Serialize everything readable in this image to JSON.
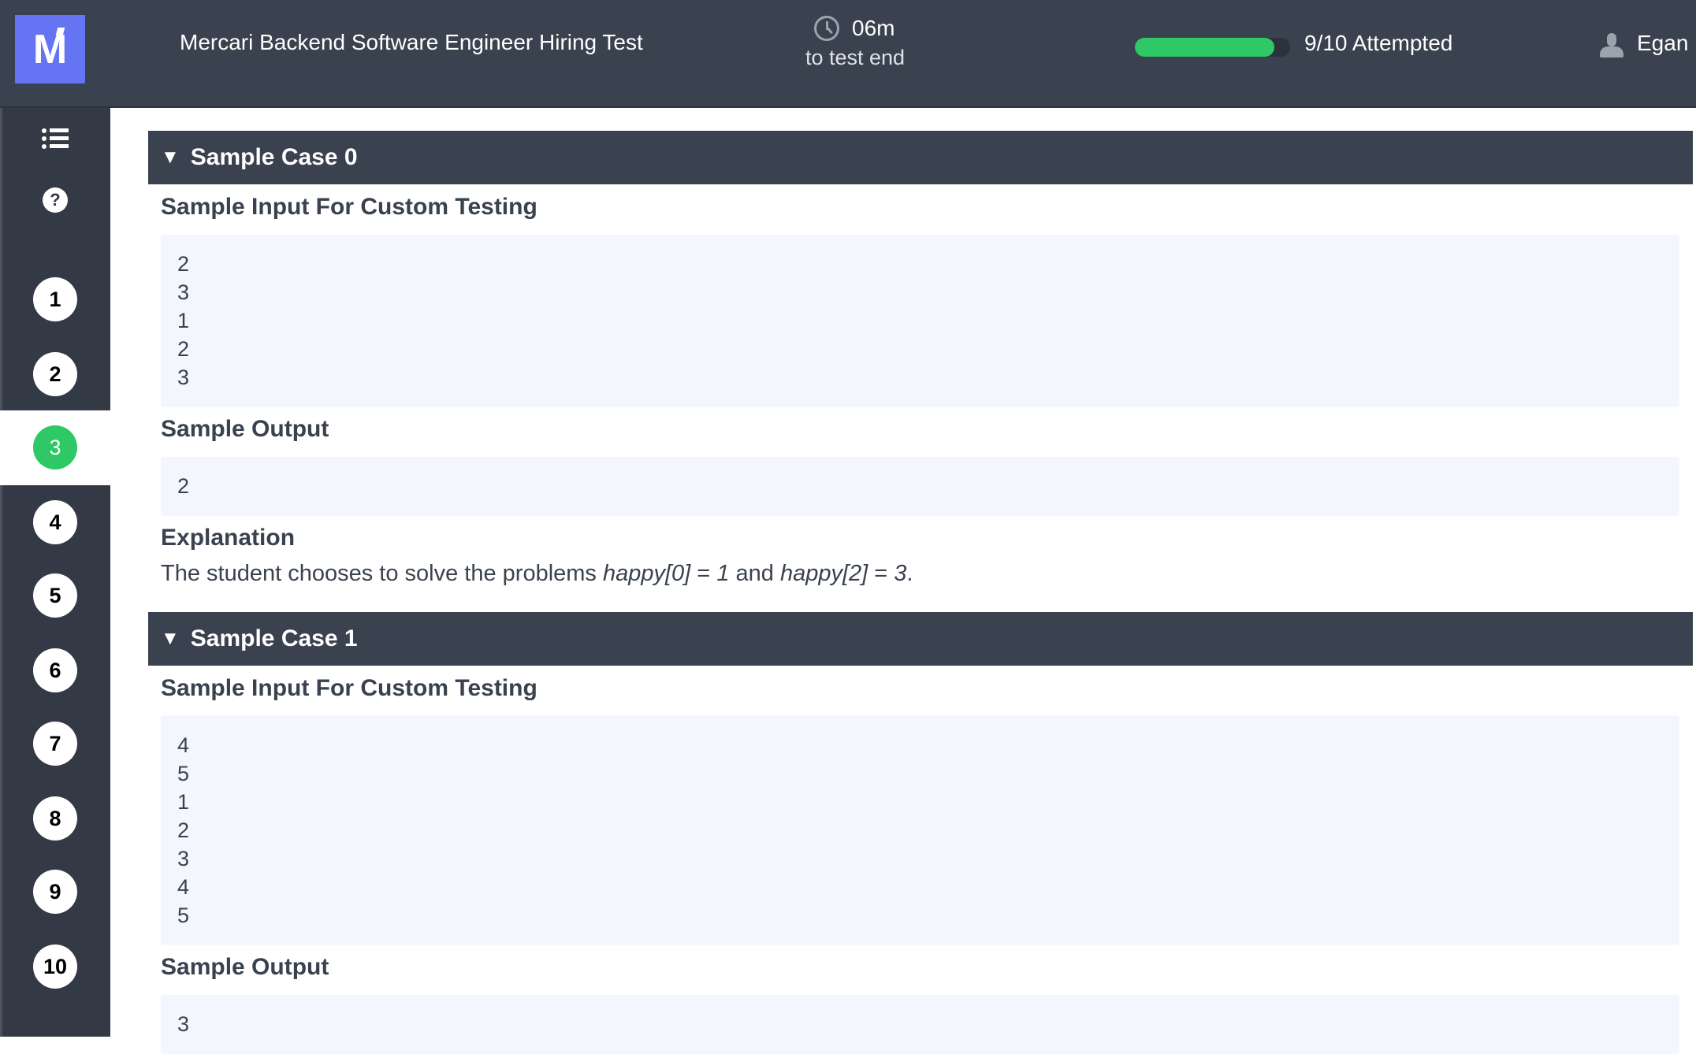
{
  "header": {
    "logo_letter": "M",
    "title": "Mercari Backend Software Engineer Hiring Test",
    "timer_value": "06m",
    "timer_label": "to test end",
    "progress_fraction": 0.9,
    "attempted_label": "9/10 Attempted",
    "user_name": "Egan I",
    "colors": {
      "background": "#39424e",
      "logo": "#6474f2",
      "progress": "#2ec866"
    }
  },
  "sidebar": {
    "help_label": "?",
    "questions": [
      "1",
      "2",
      "3",
      "4",
      "5",
      "6",
      "7",
      "8",
      "9",
      "10"
    ],
    "active_question": "3",
    "active_color": "#2ec866"
  },
  "main": {
    "cases": [
      {
        "title": "Sample Case 0",
        "input_heading": "Sample Input For Custom Testing",
        "input_lines": [
          "2",
          "3",
          "1",
          "2",
          "3"
        ],
        "output_heading": "Sample Output",
        "output_lines": [
          "2"
        ],
        "explanation_heading": "Explanation",
        "explanation": {
          "t1": "The student chooses to solve the problems ",
          "e1": "happy[0]",
          "t2": " = ",
          "e2": "1",
          "t3": " and ",
          "e3": "happy[2]",
          "t4": " = ",
          "e4": "3",
          "t5": "."
        }
      },
      {
        "title": "Sample Case 1",
        "input_heading": "Sample Input For Custom Testing",
        "input_lines": [
          "4",
          "5",
          "1",
          "2",
          "3",
          "4",
          "5"
        ],
        "output_heading": "Sample Output",
        "output_lines": [
          "3"
        ]
      }
    ]
  }
}
